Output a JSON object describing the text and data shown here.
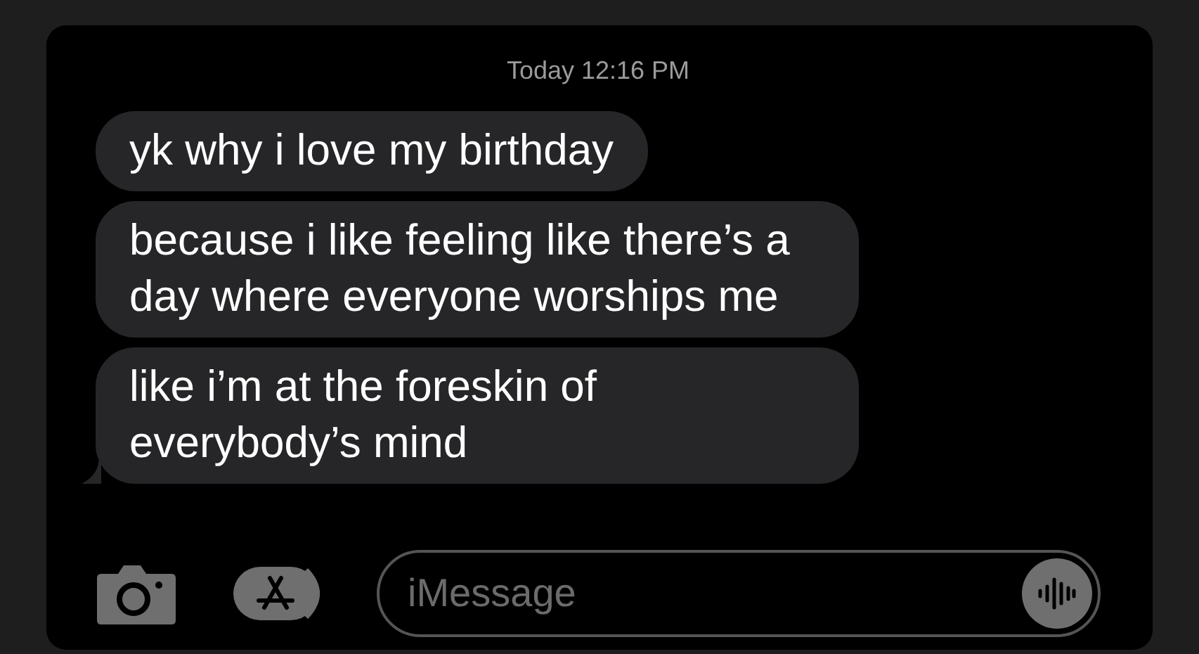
{
  "timestamp": "Today 12:16 PM",
  "messages": [
    {
      "text": "yk why i love my birthday",
      "tail": false
    },
    {
      "text": "because i like feeling like there’s a day where everyone worships me",
      "tail": false
    },
    {
      "text": "like i’m at the foreskin of everybody’s mind",
      "tail": true
    }
  ],
  "composer": {
    "placeholder": "iMessage"
  }
}
